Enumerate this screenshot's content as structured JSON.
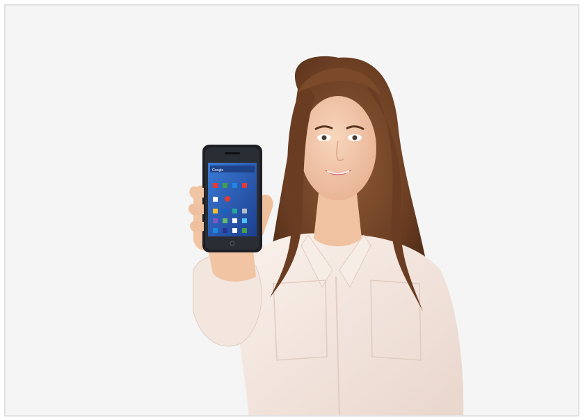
{
  "photo": {
    "subject": "woman-holding-smartphone",
    "colors": {
      "background": "#f5f5f5",
      "hair": "#7a4a2c",
      "skin": "#f3c9a8",
      "shirt": "#f4e7e0",
      "phone_body": "#1d1f24",
      "phone_screen": "#2b5fb3"
    }
  },
  "phone": {
    "search_widget_label": "Google"
  }
}
